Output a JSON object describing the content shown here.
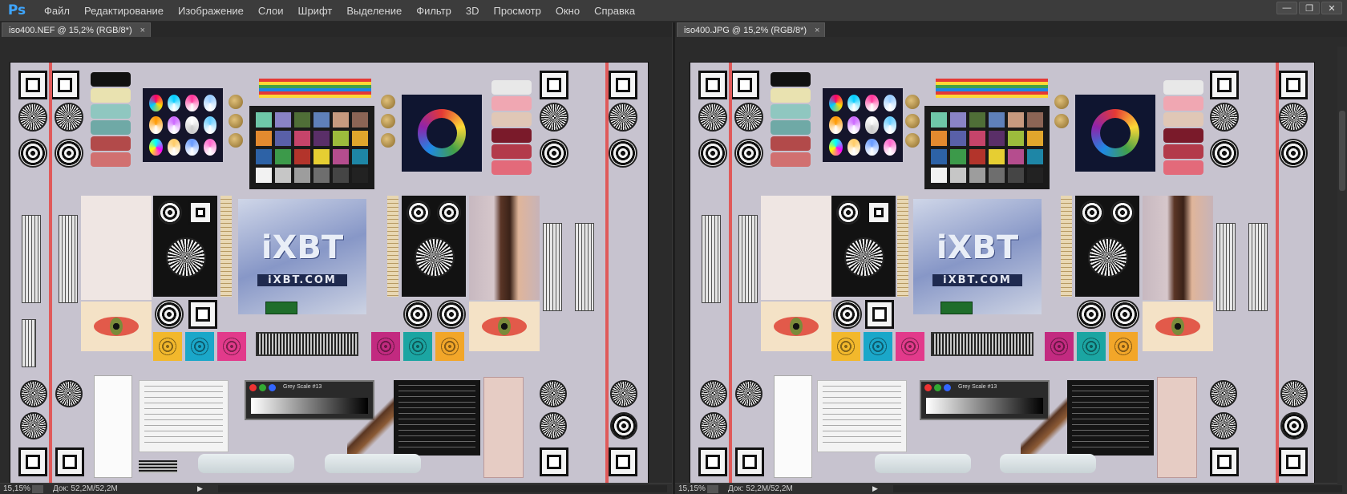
{
  "app": {
    "logo": "Ps",
    "menu": [
      "Файл",
      "Редактирование",
      "Изображение",
      "Слои",
      "Шрифт",
      "Выделение",
      "Фильтр",
      "3D",
      "Просмотр",
      "Окно",
      "Справка"
    ],
    "window_controls": [
      "minimize-icon",
      "restore-icon",
      "close-icon"
    ]
  },
  "documents": [
    {
      "tab_title": "iso400.NEF @ 15,2% (RGB/8*)",
      "tab_close": "×",
      "zoom": "15,15%",
      "doc_size": "Док: 52,2M/52,2M",
      "status_arrow": "▶"
    },
    {
      "tab_title": "iso400.JPG @ 15,2% (RGB/8*)",
      "tab_close": "×",
      "zoom": "15,15%",
      "doc_size": "Док: 52,2M/52,2M",
      "status_arrow": "▶"
    }
  ],
  "chart_image": {
    "logo_main": "iXBT",
    "logo_sub": "iXBT.COM",
    "grey_scale_label": "Grey Scale #13"
  },
  "colors": {
    "ps_blue": "#3ea6ff",
    "menubar_bg": "#3c3c3c",
    "workspace_bg": "#282828"
  }
}
